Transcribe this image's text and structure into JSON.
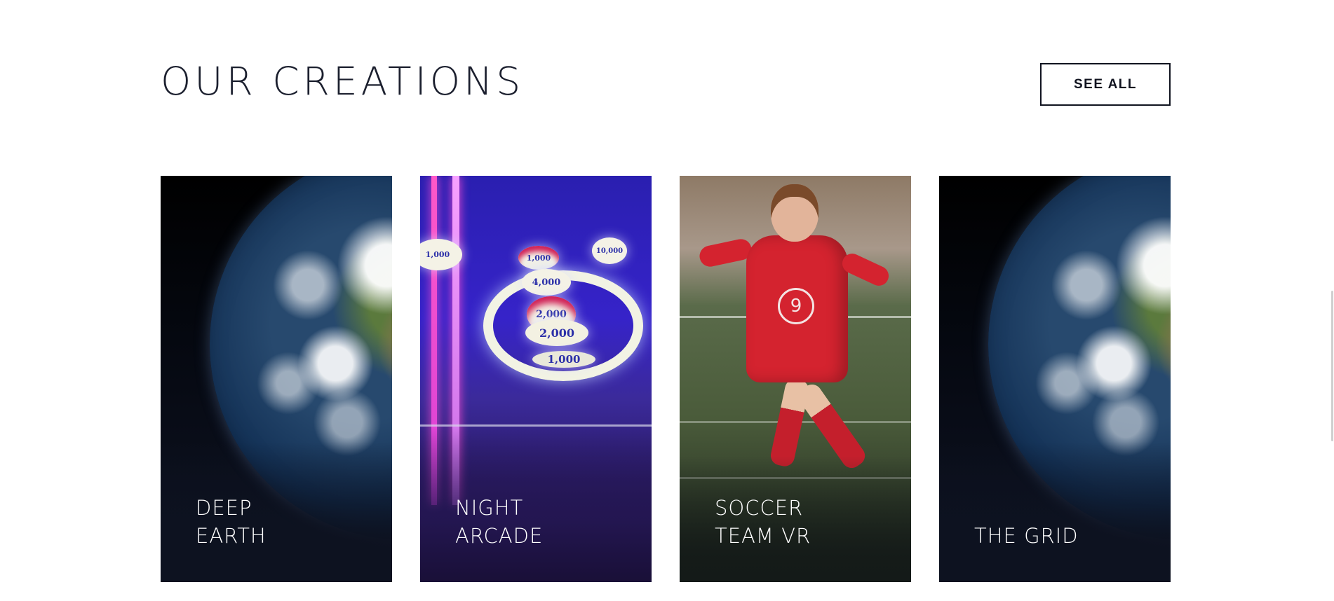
{
  "section": {
    "title": "OUR CREATIONS",
    "see_all_label": "SEE ALL"
  },
  "cards": [
    {
      "line1": "DEEP",
      "line2": "EARTH",
      "image": "earth-from-space"
    },
    {
      "line1": "NIGHT",
      "line2": "ARCADE",
      "image": "skee-ball-neon"
    },
    {
      "line1": "SOCCER",
      "line2": "TEAM VR",
      "image": "soccer-player"
    },
    {
      "line1": "",
      "line2": "THE GRID",
      "image": "earth-from-space"
    }
  ],
  "arcade_scores": [
    "1,000",
    "10,000",
    "1,000",
    "4,000",
    "2,000",
    "2,000",
    "1,000"
  ],
  "jersey_number": "9",
  "colors": {
    "title_text": "#1b1f2e",
    "button_border": "#10131f",
    "card_dark": "#0d1220",
    "card_text": "#ffffff"
  }
}
